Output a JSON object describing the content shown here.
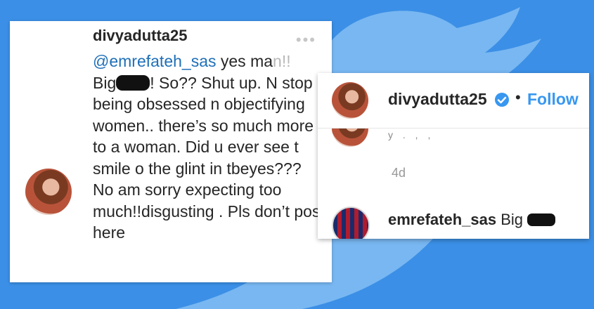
{
  "left_comment": {
    "username": "divyadutta25",
    "more_icon": "ellipsis-icon",
    "mention": "@emrefateh_sas",
    "line1_rest_a": " yes ma",
    "line1_rest_b": "n!!",
    "line2_a": "Big",
    "line2_b": "! So?? Shut up. N",
    "rest_text": "stop being obsessed n objectifying women.. there’s so much more to a woman. Did u ever see t smile o the glint in tbeyes??? No am sorry expecting too much!!disgusting . Pls don’t post here"
  },
  "right_post": {
    "username": "divyadutta25",
    "verified_icon": "verified-badge-icon",
    "separator": "•",
    "follow_label": "Follow",
    "partial_text": "y . , ,",
    "timestamp": "4d",
    "comment_user": "emrefateh_sas",
    "comment_text": "Big"
  },
  "colors": {
    "background": "#3b8fe6",
    "link": "#3897f0",
    "mention": "#1e6fb8"
  }
}
